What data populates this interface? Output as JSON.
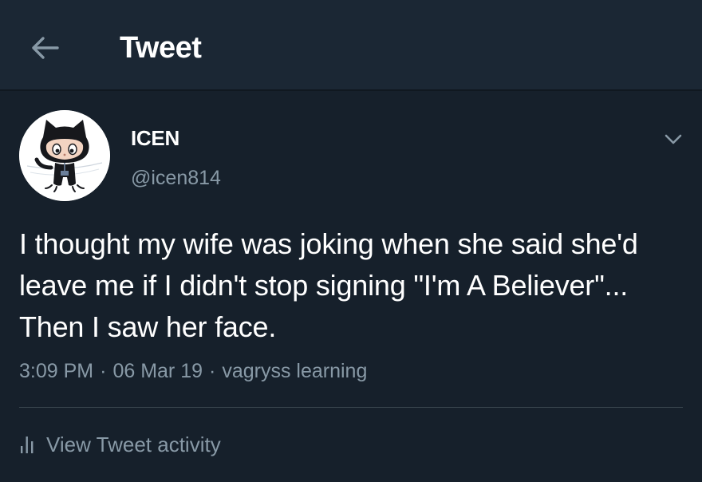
{
  "header": {
    "title": "Tweet",
    "back_icon": "arrow-left-icon"
  },
  "tweet": {
    "author": {
      "display_name": "ICEN",
      "handle": "@icen814",
      "avatar_icon": "octocat-avatar"
    },
    "text": "I thought my wife was joking when she said she'd leave me if I didn't stop signing \"I'm A Believer\"... Then I saw her face.",
    "time": "3:09 PM",
    "date": "06 Mar 19",
    "source": "vagryss learning",
    "separator": "·",
    "menu_icon": "chevron-down-icon"
  },
  "activity": {
    "label": "View Tweet activity",
    "icon": "bar-chart-icon"
  },
  "colors": {
    "background": "#16202b",
    "header_background": "#1b2734",
    "primary_text": "#ffffff",
    "secondary_text": "#8899a6",
    "divider": "#38444d"
  }
}
